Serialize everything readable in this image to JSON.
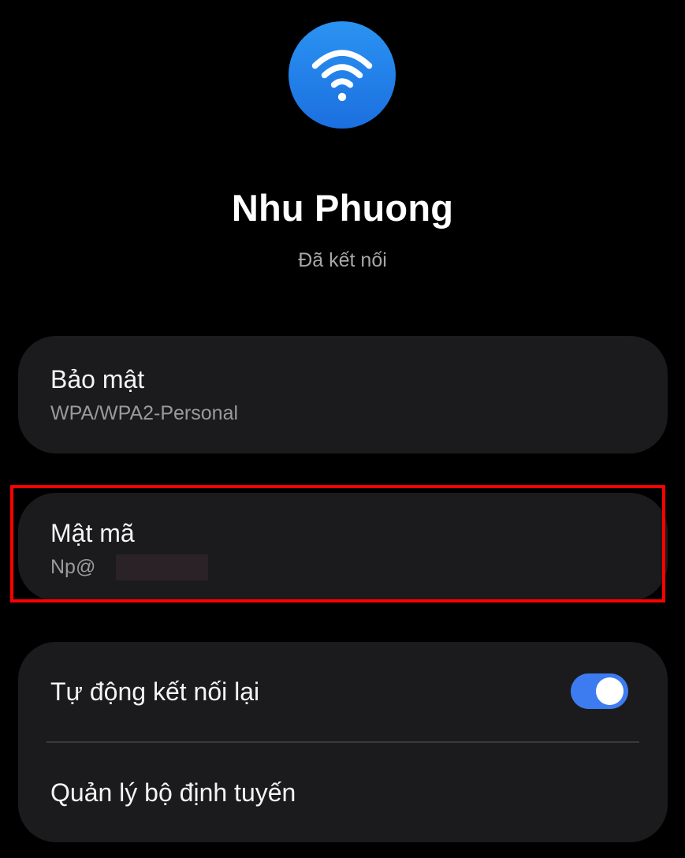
{
  "header": {
    "icon": "wifi-icon",
    "network_name": "Nhu Phuong",
    "status": "Đã kết nối"
  },
  "security": {
    "title": "Bảo mật",
    "value": "WPA/WPA2-Personal"
  },
  "password": {
    "title": "Mật mã",
    "visible_prefix": "Np@"
  },
  "options": {
    "auto_reconnect": {
      "label": "Tự động kết nối lại",
      "enabled": true
    },
    "router_management": {
      "label": "Quản lý bộ định tuyến"
    }
  },
  "colors": {
    "background": "#000000",
    "card": "#1b1b1d",
    "accent": "#3d7cf0",
    "highlight": "#ff0000"
  }
}
